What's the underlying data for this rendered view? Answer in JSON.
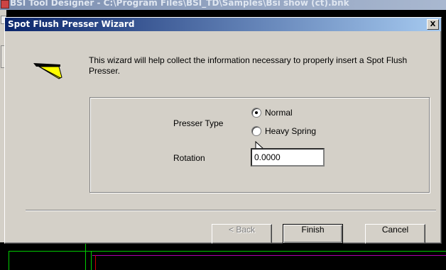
{
  "background_app": {
    "title": "BSI Tool Designer - C:\\Program Files\\BSI_TD\\Samples\\Bsi show (ct).bnk"
  },
  "dialog": {
    "title": "Spot Flush Presser Wizard",
    "close_label": "X",
    "intro_text": "This wizard will help collect the information necessary to properly insert a Spot Flush Presser.",
    "presser_type_label": "Presser Type",
    "options": [
      {
        "label": "Normal",
        "selected": true
      },
      {
        "label": "Heavy Spring",
        "selected": false
      }
    ],
    "rotation_label": "Rotation",
    "rotation_value": "0.0000",
    "buttons": {
      "back": "< Back",
      "finish": "Finish",
      "cancel": "Cancel"
    }
  },
  "colors": {
    "titlebar_start": "#0a246a",
    "titlebar_end": "#a6caf0",
    "dialog_bg": "#d4d0c8"
  }
}
